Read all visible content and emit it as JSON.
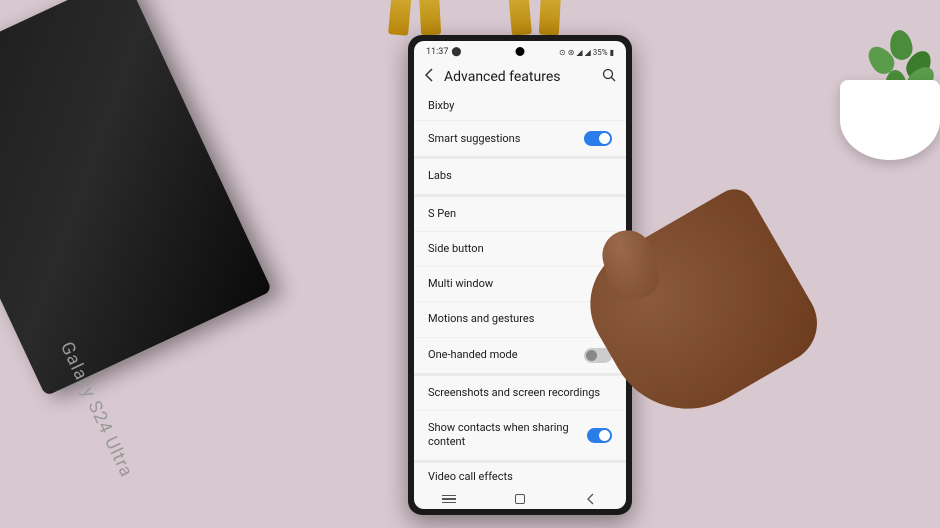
{
  "box": {
    "product_name": "Galaxy S24 Ultra"
  },
  "status_bar": {
    "time": "11:37",
    "battery": "35%"
  },
  "header": {
    "title": "Advanced features"
  },
  "settings": {
    "bixby": "Bixby",
    "smart_suggestions": "Smart suggestions",
    "labs": "Labs",
    "s_pen": "S Pen",
    "side_button": "Side button",
    "multi_window": "Multi window",
    "motions_gestures": "Motions and gestures",
    "one_handed": "One-handed mode",
    "screenshots": "Screenshots and screen recordings",
    "show_contacts": "Show contacts when sharing content",
    "video_call": "Video call effects"
  }
}
